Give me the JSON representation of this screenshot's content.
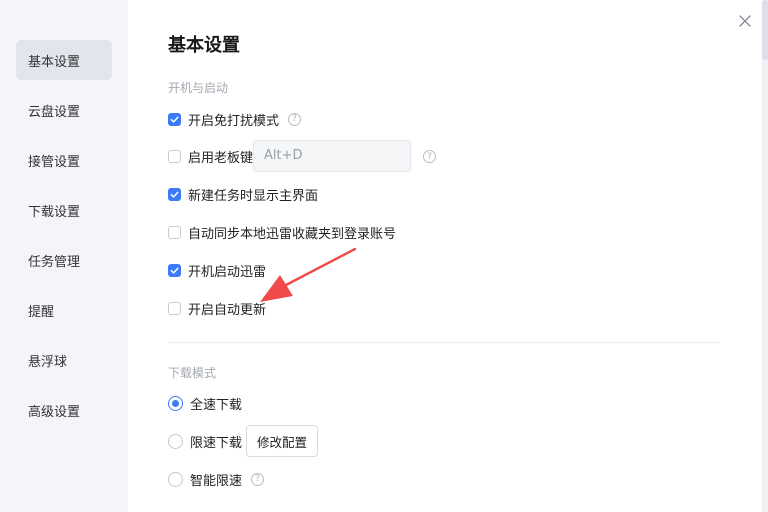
{
  "sidebar": {
    "items": [
      {
        "label": "基本设置",
        "active": true
      },
      {
        "label": "云盘设置"
      },
      {
        "label": "接管设置"
      },
      {
        "label": "下载设置"
      },
      {
        "label": "任务管理"
      },
      {
        "label": "提醒"
      },
      {
        "label": "悬浮球"
      },
      {
        "label": "高级设置"
      }
    ]
  },
  "main": {
    "title": "基本设置",
    "startup": {
      "section_label": "开机与启动",
      "options": {
        "dnd_mode": {
          "label": "开启免打扰模式",
          "checked": true
        },
        "boss_key": {
          "label": "启用老板键",
          "checked": false,
          "hotkey_value": "Alt+D"
        },
        "show_main_on_new_task": {
          "label": "新建任务时显示主界面",
          "checked": true
        },
        "sync_favorites": {
          "label": "自动同步本地迅雷收藏夹到登录账号",
          "checked": false
        },
        "launch_on_boot": {
          "label": "开机启动迅雷",
          "checked": true
        },
        "auto_update": {
          "label": "开启自动更新",
          "checked": false
        }
      }
    },
    "download_mode": {
      "section_label": "下载模式",
      "options": {
        "full_speed": {
          "label": "全速下载",
          "selected": true
        },
        "limited": {
          "label": "限速下载",
          "selected": false,
          "button_label": "修改配置"
        },
        "smart_limit": {
          "label": "智能限速",
          "selected": false
        }
      }
    }
  },
  "icons": {
    "close": "close-icon",
    "help": "help-icon",
    "check": "check-icon",
    "annotation": "red-arrow-icon"
  },
  "colors": {
    "accent": "#3b7bf5",
    "sidebar_bg": "#f3f5fa",
    "annotation_arrow": "#f04a4a"
  }
}
